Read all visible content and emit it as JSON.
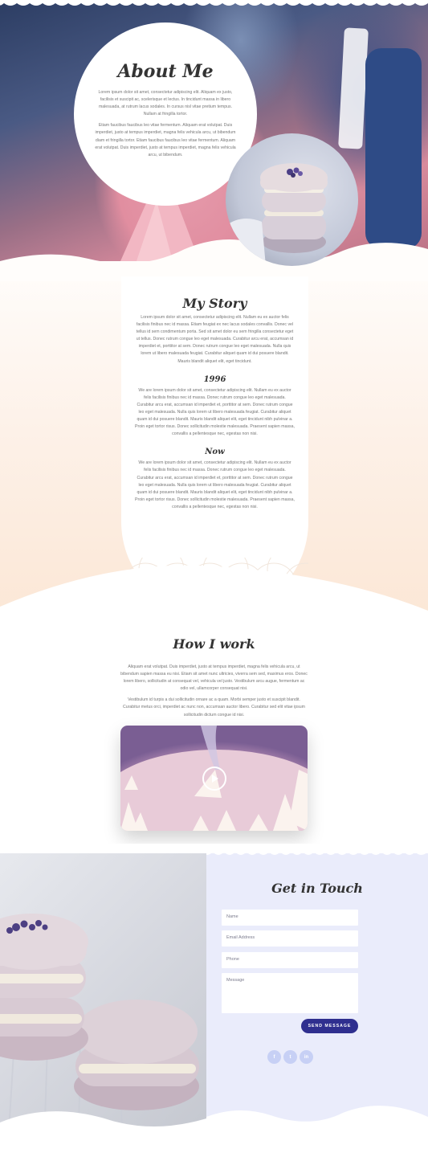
{
  "about": {
    "title": "About Me",
    "p1": "Lorem ipsum dolor sit amet, consectetur adipiscing elit. Aliquam ex justo, facilisis et suscipit ac, scelerisque et lectus. In tincidunt massa in libero malesuada, at rutrum lacus sodales. In cursus nisl vitae pretium tempus. Nullam at fringilla tortor.",
    "p2": "Etiam faucibus faucibus leo vitae fermentum. Aliquam erat volutpat. Duis imperdiet, justo at tempus imperdiet, magna felis vehicula arcu, ut bibendum diam et fringilla tortor. Etiam faucibus faucibus leo vitae fermentum. Aliquam erat volutpat. Duis imperdiet, justo at tempus imperdiet, magna felis vehicula arcu, ut bibendum."
  },
  "story": {
    "title": "My Story",
    "intro": "Lorem ipsum dolor sit amet, consectetur adipiscing elit. Nullam eu ex auctor felis facilisis finibus nec id massa. Etiam feugiat ex nec lacus sodales convallis. Donec vel tellus id sem condimentum porta. Sed sit amet dolor eu sem fringilla consectetur eget ut tellus. Donec rutrum congue leo eget malesuada. Curabitur arcu erat, accumsan id imperdiet et, porttitor at sem. Donec rutrum congue leo eget malesuada. Nulla quis lorem ut libero malesuada feugiat. Curabitur aliquet quam id dui posuere blandit. Mauris blandit aliquet elit, eget tincidunt.",
    "year_heading": "1996",
    "year_text": "We are lorem ipsum dolor sit amet, consectetur adipiscing elit. Nullam eu ex auctor felis facilisis finibus nec id massa. Donec rutrum congue leo eget malesuada. Curabitur arcu erat, accumsan id imperdiet et, porttitor at sem. Donec rutrum congue leo eget malesuada. Nulla quis lorem ut libero malesuada feugiat. Curabitur aliquet quam id dui posuere blandit. Mauris blandit aliquet elit, eget tincidunt nibh pulvinar a. Proin eget tortor risus. Donec sollicitudin molestie malesuada. Praesent sapien massa, convallis a pellentesque nec, egestas non nisi.",
    "now_heading": "Now",
    "now_text": "We are lorem ipsum dolor sit amet, consectetur adipiscing elit. Nullam eu ex auctor felis facilisis finibus nec id massa. Donec rutrum congue leo eget malesuada. Curabitur arcu erat, accumsan id imperdiet et, porttitor at sem. Donec rutrum congue leo eget malesuada. Nulla quis lorem ut libero malesuada feugiat. Curabitur aliquet quam id dui posuere blandit. Mauris blandit aliquet elit, eget tincidunt nibh pulvinar a. Proin eget tortor risus. Donec sollicitudin molestie malesuada. Praesent sapien massa, convallis a pellentesque nec, egestas non nisi."
  },
  "how": {
    "title": "How I work",
    "p1": "Aliquam erat volutpat. Duis imperdiet, justo at tempus imperdiet, magna felis vehicula arcu, ut bibendum sapien massa eu nisi. Etiam sit amet nunc ultricies, viverra sem sed, maximus eros. Donec lorem libero, sollicitudin at consequat vel, vehicula vel justo. Vestibulum arcu augue, fermentum ac odio vel, ullamcorper consequat nisi.",
    "p2": "Vestibulum id turpis a dui sollicitudin ornare ac a quam. Morbi semper justo et suscipit blandit. Curabitur metus orci, imperdiet ac nunc non, accumsan auctor libero. Curabitur sed elit vitae ipsum sollicitudin dictum congue id nisi.",
    "play_icon": "play-icon"
  },
  "contact": {
    "title": "Get in Touch",
    "name_placeholder": "Name",
    "email_placeholder": "Email Address",
    "phone_placeholder": "Phone",
    "message_placeholder": "Message",
    "send_label": "SEND MESSAGE",
    "social": {
      "facebook": "f",
      "twitter": "t",
      "linkedin": "in"
    }
  },
  "colors": {
    "accent": "#2f2f8f",
    "social": "#c7d0f5",
    "contact_bg": "#eaecfb",
    "story_bg": "#fbe6d4"
  }
}
